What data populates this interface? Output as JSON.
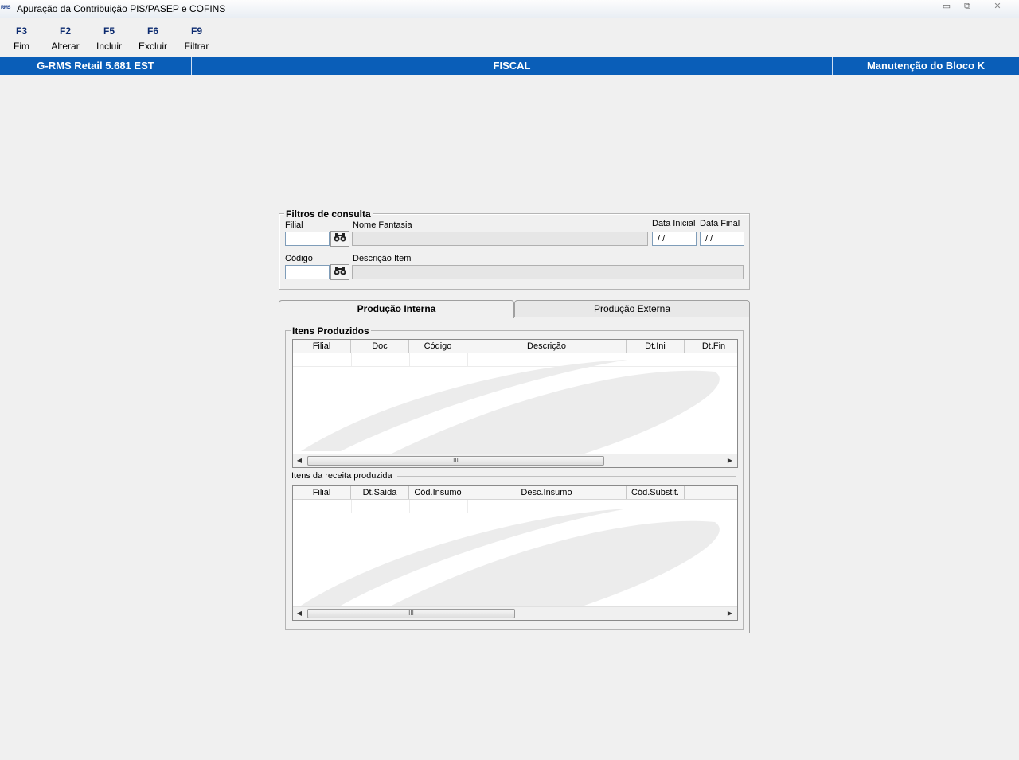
{
  "window": {
    "icon_text": "RMS",
    "title": "Apuração da Contribuição PIS/PASEP e COFINS",
    "min_symbol": "▭",
    "max_symbol": "⧉",
    "close_symbol": "✕"
  },
  "toolbar": {
    "buttons": [
      {
        "key": "F3",
        "label": "Fim"
      },
      {
        "key": "F2",
        "label": "Alterar"
      },
      {
        "key": "F5",
        "label": "Incluir"
      },
      {
        "key": "F6",
        "label": "Excluir"
      },
      {
        "key": "F9",
        "label": "Filtrar"
      }
    ]
  },
  "status_strip": {
    "left": "G-RMS Retail 5.681 EST",
    "center": "FISCAL",
    "right": "Manutenção do Bloco K",
    "color": "#0a5eb8"
  },
  "filters": {
    "title": "Filtros de consulta",
    "filial_label": "Filial",
    "nome_fantasia_label": "Nome Fantasia",
    "data_inicial_label": "Data Inicial",
    "data_final_label": "Data Final",
    "data_inicial_value": "/ /",
    "data_final_value": "/ /",
    "codigo_label": "Código",
    "descricao_item_label": "Descrição Item",
    "search_icon_glyph": "🔭"
  },
  "tabs": {
    "active": "Produção Interna",
    "inactive": "Produção Externa"
  },
  "itens_produzidos": {
    "title": "Itens Produzidos",
    "columns": [
      "Filial",
      "Doc",
      "Código",
      "Descrição",
      "Dt.Ini",
      "Dt.Fin"
    ]
  },
  "itens_receita": {
    "title": "Itens da receita produzida",
    "columns": [
      "Filial",
      "Dt.Saída",
      "Cód.Insumo",
      "Desc.Insumo",
      "Cód.Substit.",
      ""
    ]
  },
  "scrollbar": {
    "left_arrow": "◀",
    "right_arrow": "▶",
    "grip": "III"
  }
}
